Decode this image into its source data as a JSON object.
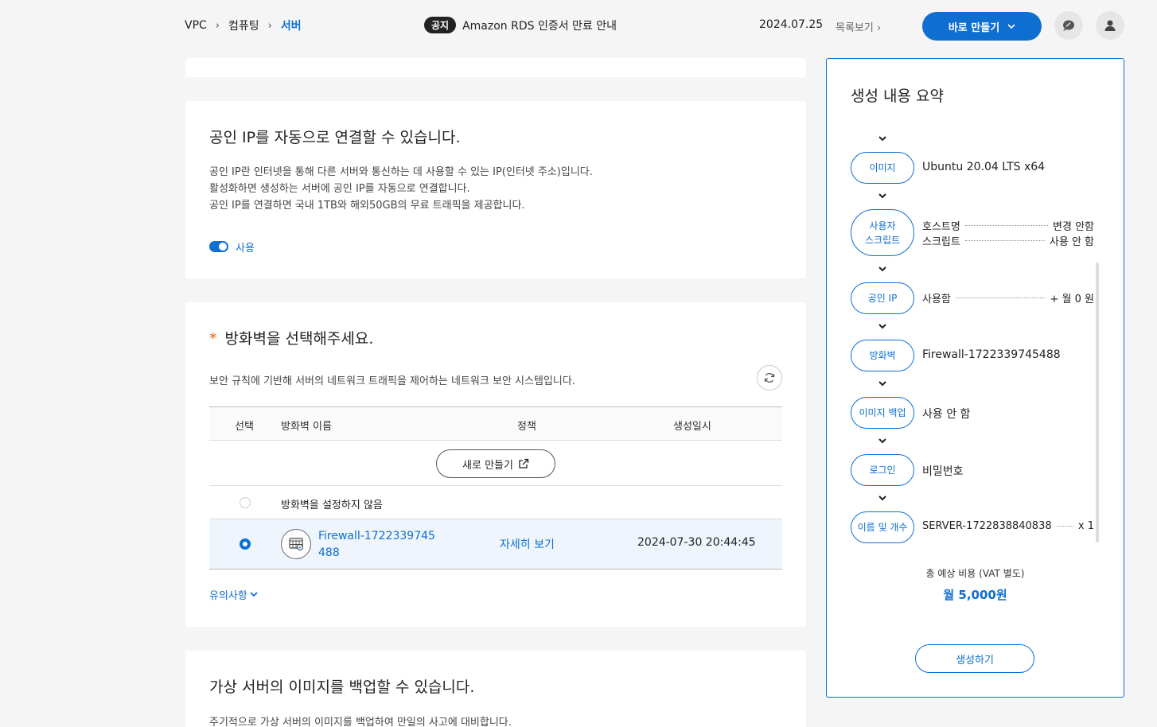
{
  "breadcrumb": [
    "VPC",
    "컴퓨팅",
    "서버"
  ],
  "notice": {
    "badge": "공지",
    "text": "Amazon RDS 인증서 만료 안내"
  },
  "header": {
    "date": "2024.07.25",
    "list_link": "목록보기",
    "create_now": "바로 만들기"
  },
  "public_ip": {
    "title": "공인 IP를 자동으로 연결할 수 있습니다.",
    "desc": [
      "공인 IP란 인터넷을 통해 다른 서버와 통신하는 데 사용할 수 있는 IP(인터넷 주소)입니다.",
      "활성화하면 생성하는 서버에 공인 IP를 자동으로 연결합니다.",
      "공인 IP를 연결하면 국내 1TB와 해외50GB의 무료 트래픽을 제공합니다."
    ],
    "toggle_label": "사용"
  },
  "firewall": {
    "required_mark": "*",
    "title": "방화벽을 선택해주세요.",
    "desc": "보안 규칙에 기반해 서버의 네트워크 트래픽을 제어하는 네트워크 보안 시스템입니다.",
    "columns": [
      "선택",
      "방화벽 이름",
      "정책",
      "생성일시"
    ],
    "new_button": "새로 만들기",
    "none_option": "방화벽을 설정하지 않음",
    "selected": {
      "name_line1": "Firewall-1722339745",
      "name_line2": "488",
      "detail": "자세히 보기",
      "created": "2024-07-30 20:44:45"
    },
    "caution": "유의사항"
  },
  "backup": {
    "title": "가상 서버의 이미지를 백업할 수 있습니다.",
    "desc": "주기적으로 가상 서버의 이미지를 백업하여 만일의 사고에 대비합니다."
  },
  "summary": {
    "title": "생성 내용 요약",
    "image": {
      "label": "이미지",
      "value": "Ubuntu 20.04 LTS x64"
    },
    "user_script": {
      "label_line1": "사용자",
      "label_line2": "스크립트",
      "hostname": "호스트명",
      "hostname_val": "변경 안함",
      "script": "스크립트",
      "script_val": "사용 안 함"
    },
    "public_ip": {
      "label": "공인 IP",
      "value": "사용함",
      "price": "+ 월 0 원"
    },
    "firewall": {
      "label": "방화벽",
      "value": "Firewall-1722339745488"
    },
    "image_backup": {
      "label": "이미지 백업",
      "value": "사용 안 함"
    },
    "login": {
      "label": "로그인",
      "value": "비밀번호"
    },
    "name_count": {
      "label": "이름 및 개수",
      "value": "SERVER-1722838840838",
      "count": "x 1"
    },
    "total_label": "총 예상 비용 (VAT 별도)",
    "total_value": "월 5,000원",
    "generate": "생성하기"
  },
  "colors": {
    "accent": "#0e6fd1",
    "required": "#e0661a",
    "badge": "#222222"
  }
}
